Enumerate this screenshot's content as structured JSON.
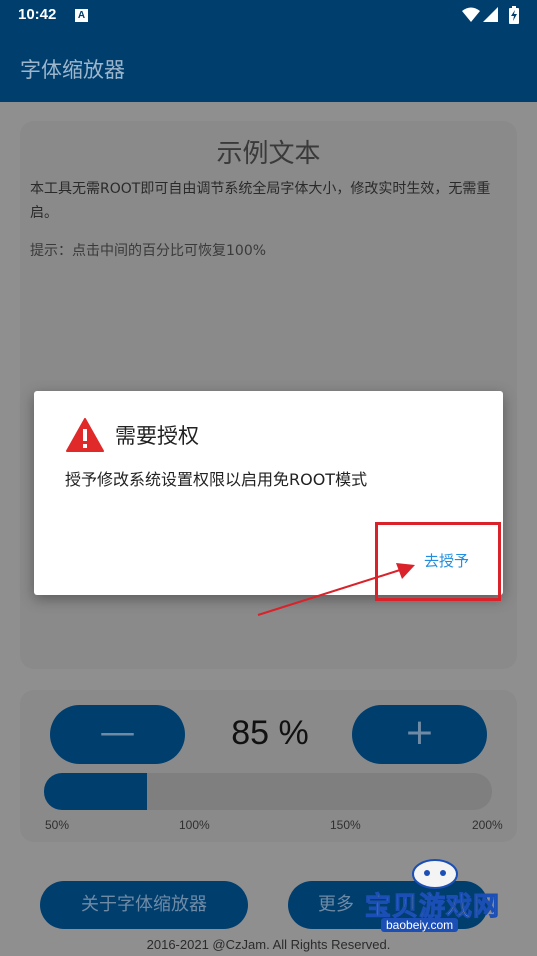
{
  "status_bar": {
    "time": "10:42",
    "notification_icon": "A"
  },
  "app_bar": {
    "title": "字体缩放器"
  },
  "sample_card": {
    "title": "示例文本",
    "body": "本工具无需ROOT即可自由调节系统全局字体大小，修改实时生效，无需重启。",
    "hint": "提示：点击中间的百分比可恢复100%"
  },
  "scale_panel": {
    "minus_label": "—",
    "plus_label": "+",
    "percent_label": "85 %",
    "slider_fraction": 0.23,
    "ticks": [
      "50%",
      "100%",
      "150%",
      "200%"
    ]
  },
  "bottom": {
    "about_label": "关于字体缩放器",
    "more_label": "更多",
    "copyright": "2016-2021 @CzJam. All Rights Reserved."
  },
  "dialog": {
    "title": "需要授权",
    "message": "授予修改系统设置权限以启用免ROOT模式",
    "positive_button": "去授予"
  },
  "watermark": {
    "text": "宝贝游戏网",
    "url": "baobeiy.com"
  },
  "colors": {
    "primary": "#003e6e",
    "accent": "#1f8ee0",
    "highlight": "#d9222a",
    "warning": "#e02a2a"
  }
}
